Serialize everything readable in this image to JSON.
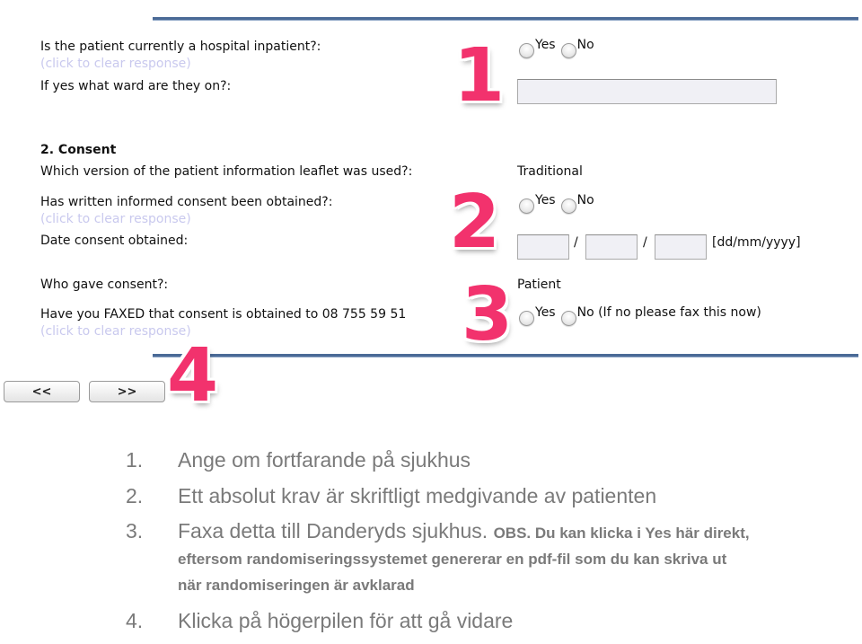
{
  "form": {
    "inpatient": {
      "question": "Is the patient currently a hospital inpatient?:",
      "clear_link": "(click to clear response)",
      "options": [
        "Yes",
        "No"
      ]
    },
    "ward": {
      "question": "If yes what ward are they on?:",
      "value": ""
    },
    "consent_section": {
      "heading": "2. Consent",
      "leaflet_question": "Which version of the patient information leaflet was used?:",
      "leaflet_value": "Traditional",
      "written_consent_question": "Has written informed consent been obtained?:",
      "written_consent_clear": "(click to clear response)",
      "written_consent_options": [
        "Yes",
        "No"
      ],
      "date_question": "Date consent obtained:",
      "date_day": "",
      "date_month": "",
      "date_year": "",
      "date_separator": "/",
      "date_format_hint": "[dd/mm/yyyy]",
      "who_question": "Who gave consent?:",
      "who_value": "Patient",
      "faxed_question": "Have you FAXED that consent is obtained to 08 755 59 51",
      "faxed_clear": "(click to clear response)",
      "faxed_options": [
        "Yes",
        "No (If no please fax this now)"
      ]
    },
    "nav": {
      "back_label": "<<",
      "next_label": ">>"
    }
  },
  "badges": [
    "1",
    "2",
    "3",
    "4"
  ],
  "notes": [
    {
      "num": "1.",
      "text": "Ange om fortfarande på sjukhus"
    },
    {
      "num": "2.",
      "text": "Ett absolut krav är skriftligt medgivande av patienten"
    },
    {
      "num": "3.",
      "text": "Faxa detta till Danderyds sjukhus.",
      "bold": "OBS. Du kan klicka i Yes här direkt, eftersom randomiseringssystemet genererar en pdf-fil som du kan skriva ut när randomiseringen är avklarad"
    },
    {
      "num": "4.",
      "text": "Klicka på högerpilen för att gå vidare"
    }
  ],
  "colors": {
    "rule": "#4a6a96",
    "badge": "#f2326d",
    "clear_link": "#c9c9ee",
    "notes_text": "#7a7a7a"
  }
}
